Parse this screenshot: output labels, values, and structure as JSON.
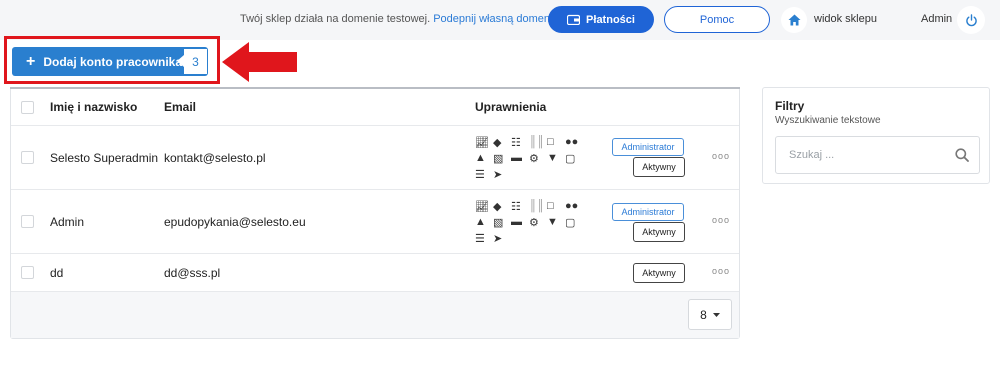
{
  "topbar": {
    "notice_text": "Twój sklep działa na domenie testowej. ",
    "notice_link": "Podepnij własną domenę",
    "payments_label": "Płatności",
    "help_label": "Pomoc",
    "shop_view_label": "widok sklepu",
    "user_label": "Admin"
  },
  "add_button": {
    "label": "Dodaj konto pracownika",
    "count": "3"
  },
  "table": {
    "headers": {
      "name": "Imię i nazwisko",
      "email": "Email",
      "permissions": "Uprawnienia"
    },
    "rows": [
      {
        "name": "Selesto Superadmin",
        "email": "kontakt@selesto.pl",
        "role": "Administrator",
        "status": "Aktywny",
        "more": "ooo"
      },
      {
        "name": "Admin",
        "email": "epudopykania@selesto.eu",
        "role": "Administrator",
        "status": "Aktywny",
        "more": "ooo"
      },
      {
        "name": "dd",
        "email": "dd@sss.pl",
        "role": "",
        "status": "Aktywny",
        "more": "ooo"
      }
    ],
    "page_size": "8"
  },
  "filters": {
    "title": "Filtry",
    "subtitle": "Wyszukiwanie tekstowe",
    "search_placeholder": "Szukaj ..."
  },
  "colors": {
    "primary_blue": "#1f64d6",
    "button_blue": "#2a7fcf",
    "highlight_red": "#e0161c"
  },
  "icons": [
    "chart-icon",
    "tags-icon",
    "sitemap-icon",
    "barcode-icon",
    "devices-icon",
    "users-icon",
    "user-secret-icon",
    "cubes-icon",
    "credit-card-icon",
    "cogs-icon",
    "cart-icon",
    "note-icon",
    "list-icon",
    "send-icon"
  ]
}
